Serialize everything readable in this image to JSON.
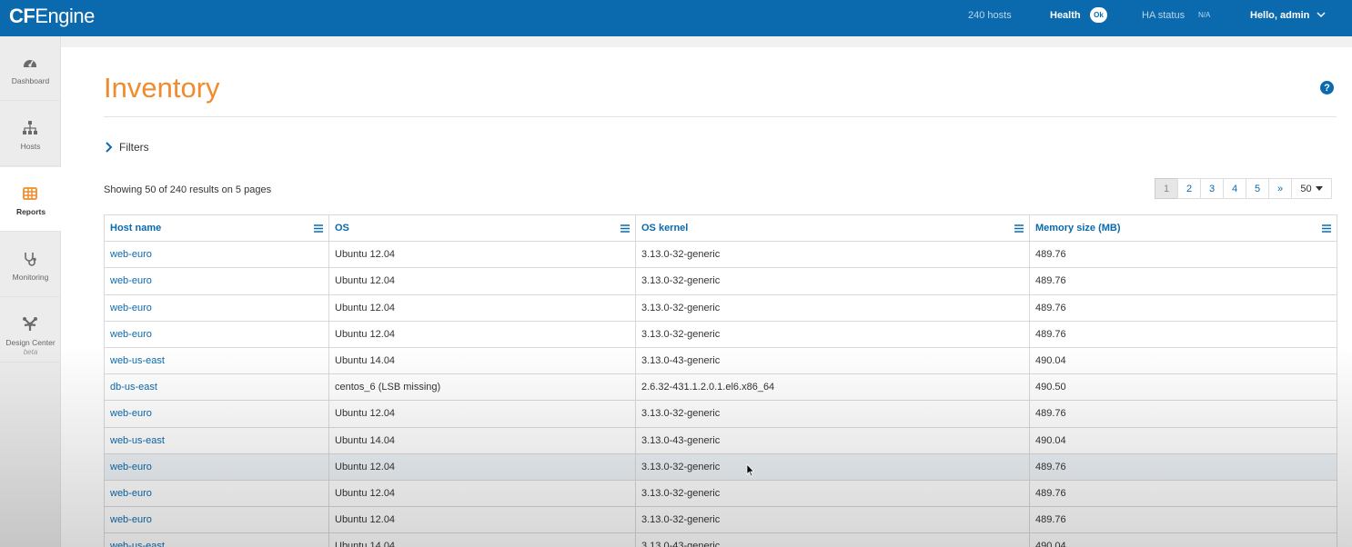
{
  "topbar": {
    "logo_bold": "CF",
    "logo_rest": "Engine",
    "hosts": "240 hosts",
    "health_label": "Health",
    "health_badge": "Ok",
    "ha_label": "HA status",
    "ha_value": "N/A",
    "user": "Hello, admin",
    "colors": {
      "bar": "#0b6aad",
      "accent": "#f08c2e"
    }
  },
  "sidebar": {
    "items": [
      {
        "label": "Dashboard",
        "icon": "dashboard-gauge-icon"
      },
      {
        "label": "Hosts",
        "icon": "hosts-hierarchy-icon"
      },
      {
        "label": "Reports",
        "icon": "reports-table-icon",
        "active": true
      },
      {
        "label": "Monitoring",
        "icon": "monitoring-stethoscope-icon"
      },
      {
        "label": "Design Center",
        "sub": "beta",
        "icon": "design-center-icon"
      }
    ]
  },
  "page": {
    "title": "Inventory",
    "filters_label": "Filters",
    "showing": "Showing 50 of 240 results on 5 pages",
    "pagination": [
      "1",
      "2",
      "3",
      "4",
      "5",
      "»"
    ],
    "current_page": "1",
    "page_size": "50"
  },
  "table": {
    "headers": [
      "Host name",
      "OS",
      "OS kernel",
      "Memory size (MB)"
    ],
    "rows": [
      [
        "web-euro",
        "Ubuntu 12.04",
        "3.13.0-32-generic",
        "489.76"
      ],
      [
        "web-euro",
        "Ubuntu 12.04",
        "3.13.0-32-generic",
        "489.76"
      ],
      [
        "web-euro",
        "Ubuntu 12.04",
        "3.13.0-32-generic",
        "489.76"
      ],
      [
        "web-euro",
        "Ubuntu 12.04",
        "3.13.0-32-generic",
        "489.76"
      ],
      [
        "web-us-east",
        "Ubuntu 14.04",
        "3.13.0-43-generic",
        "490.04"
      ],
      [
        "db-us-east",
        "centos_6 (LSB missing)",
        "2.6.32-431.1.2.0.1.el6.x86_64",
        "490.50"
      ],
      [
        "web-euro",
        "Ubuntu 12.04",
        "3.13.0-32-generic",
        "489.76"
      ],
      [
        "web-us-east",
        "Ubuntu 14.04",
        "3.13.0-43-generic",
        "490.04"
      ],
      [
        "web-euro",
        "Ubuntu 12.04",
        "3.13.0-32-generic",
        "489.76"
      ],
      [
        "web-euro",
        "Ubuntu 12.04",
        "3.13.0-32-generic",
        "489.76"
      ],
      [
        "web-euro",
        "Ubuntu 12.04",
        "3.13.0-32-generic",
        "489.76"
      ],
      [
        "web-us-east",
        "Ubuntu 14.04",
        "3.13.0-43-generic",
        "490.04"
      ]
    ],
    "highlighted_row": 8
  }
}
